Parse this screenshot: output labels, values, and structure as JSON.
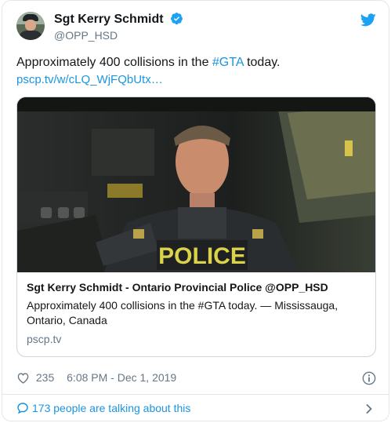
{
  "author": {
    "display_name": "Sgt Kerry Schmidt",
    "handle": "@OPP_HSD"
  },
  "tweet": {
    "text_before": "Approximately 400 collisions in the ",
    "hashtag": "#GTA",
    "text_after": " today.",
    "link": "pscp.tv/w/cLQ_WjFQbUtx…"
  },
  "card": {
    "media_text": "POLICE",
    "title": "Sgt Kerry Schmidt - Ontario Provincial Police @OPP_HSD",
    "description": "Approximately 400 collisions in the #GTA today. — Mississauga, Ontario, Canada",
    "domain": "pscp.tv"
  },
  "meta": {
    "likes": "235",
    "timestamp": "6:08 PM - Dec 1, 2019"
  },
  "conversation": {
    "label": "173 people are talking about this"
  },
  "icons": {
    "verified": "verified-badge-icon",
    "twitter": "twitter-bird-icon",
    "heart": "heart-icon",
    "info": "info-icon",
    "bubble": "speech-bubble-icon",
    "chevron": "chevron-right-icon"
  },
  "colors": {
    "accent": "#1b95e0",
    "muted": "#657786",
    "border": "#e1e8ed"
  }
}
